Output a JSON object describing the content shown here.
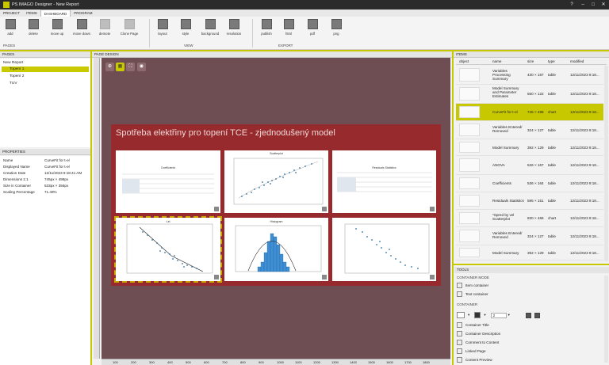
{
  "app": {
    "title": "PS IMAGO Designer - New Report",
    "help": "?",
    "min": "–",
    "max": "□",
    "close": "✕"
  },
  "menu": {
    "items": [
      "PROJECT",
      "ITEMS",
      "DASHBOARD",
      "PROGRAM"
    ]
  },
  "ribbon": {
    "pages_buttons": [
      "add",
      "delete",
      "move up",
      "move down",
      "demote",
      "Clone Page"
    ],
    "view_buttons": [
      "layout",
      "style",
      "background",
      "resolution"
    ],
    "export_buttons": [
      "publish",
      "html",
      "pdf",
      "png"
    ],
    "groups": [
      "PAGES",
      "VIEW",
      "EXPORT"
    ]
  },
  "pages_panel": {
    "header": "PAGES",
    "tree": [
      {
        "label": "New Report",
        "selected": false
      },
      {
        "label": "Topení 1",
        "selected": true
      },
      {
        "label": "Topení 2",
        "selected": false
      },
      {
        "label": "TUV",
        "selected": false
      }
    ]
  },
  "properties_panel": {
    "header": "PROPERTIES",
    "rows": [
      {
        "k": "Name",
        "v": "CurveFit for t-el"
      },
      {
        "k": "Displayed Name",
        "v": "CurveFit for t-el"
      },
      {
        "k": "Creation Date",
        "v": "12/11/2023 9:18:41 AM"
      },
      {
        "k": "Dimensions 1:1",
        "v": "745px × 498px"
      },
      {
        "k": "Size in Container",
        "v": "533px × 356px"
      },
      {
        "k": "Scaling Percentage",
        "v": "71.49%"
      }
    ]
  },
  "design": {
    "header": "PAGE DESIGN",
    "zoom_in": "⊕",
    "grid": "▦",
    "fit": "⛶",
    "preview": "◉",
    "page_title": "Spotřeba elektřiny pro topení TCE - zjednodušený model",
    "tiles": [
      "Coefficients",
      "Scatterplot",
      "Residuals Statistics",
      "t-el",
      "Histogram",
      ""
    ],
    "ruler_ticks": [
      "100",
      "200",
      "300",
      "400",
      "500",
      "600",
      "700",
      "800",
      "900",
      "1000",
      "1100",
      "1200",
      "1300",
      "1400",
      "1500",
      "1600",
      "1700",
      "1800"
    ]
  },
  "items_panel": {
    "header": "ITEMS",
    "columns": [
      "object",
      "name",
      "size",
      "type",
      "modified"
    ],
    "rows": [
      {
        "name": "Variables Processing Summary",
        "size": "430 × 187",
        "type": "table",
        "modified": "12/11/2023 9:18..."
      },
      {
        "name": "Model Summary and Parameter Estimates",
        "size": "550 × 122",
        "type": "table",
        "modified": "12/11/2023 9:18..."
      },
      {
        "name": "CurveFit for t-el",
        "size": "745 × 498",
        "type": "chart",
        "modified": "12/11/2023 9:18..."
      },
      {
        "name": "Variables Entered/ Removed",
        "size": "324 × 127",
        "type": "table",
        "modified": "12/11/2023 9:18..."
      },
      {
        "name": "Model Summary",
        "size": "392 × 129",
        "type": "table",
        "modified": "12/11/2023 9:18..."
      },
      {
        "name": "ANOVA",
        "size": "526 × 167",
        "type": "table",
        "modified": "12/11/2023 9:18..."
      },
      {
        "name": "Coefficients",
        "size": "536 × 164",
        "type": "table",
        "modified": "12/11/2023 9:18..."
      },
      {
        "name": "Residuals Statistics",
        "size": "595 × 151",
        "type": "table",
        "modified": "12/11/2023 9:18..."
      },
      {
        "name": "*Spred by vel Scatterplot",
        "size": "830 × 466",
        "type": "chart",
        "modified": "12/11/2023 9:18..."
      },
      {
        "name": "Variables Entered/ Removed",
        "size": "324 × 127",
        "type": "table",
        "modified": "12/11/2023 9:18..."
      },
      {
        "name": "Model Summary",
        "size": "392 × 129",
        "type": "table",
        "modified": "12/11/2023 9:18..."
      }
    ]
  },
  "tools_panel": {
    "header": "TOOLS",
    "section_mode": "CONTAINER MODE",
    "mode_items": [
      "Item container",
      "Text container"
    ],
    "section_container": "CONTAINER",
    "spinner_value": "2",
    "container_items": [
      "Container Title",
      "Container Description",
      "Comment to Content",
      "Linked Page",
      "Content Preview"
    ]
  },
  "colors": {
    "accent": "#c8c800",
    "page": "#962a2c",
    "canvas": "#6e4e53"
  }
}
